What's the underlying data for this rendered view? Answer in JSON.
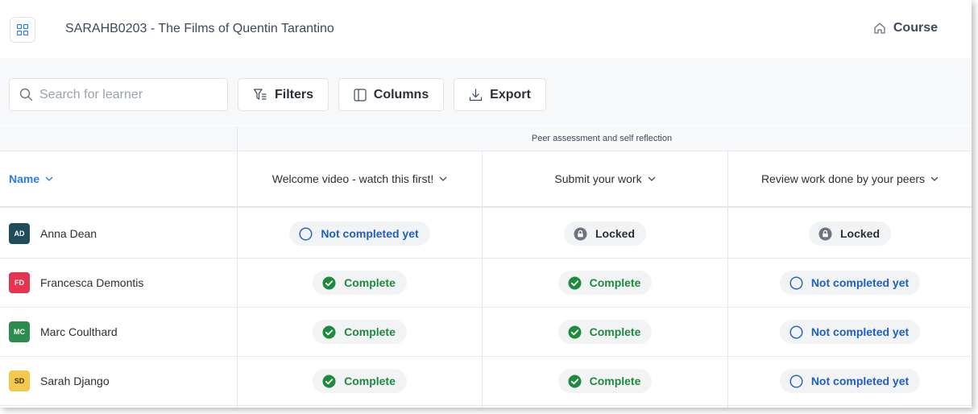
{
  "header": {
    "course_title": "SARAHB0203 - The Films of Quentin Tarantino",
    "course_link_label": "Course"
  },
  "toolbar": {
    "search_placeholder": "Search for learner",
    "filters_label": "Filters",
    "columns_label": "Columns",
    "export_label": "Export"
  },
  "table": {
    "group_label": "Peer assessment and self reflection",
    "columns": {
      "name": "Name",
      "col1": "Welcome video - watch this first!",
      "col2": "Submit your work",
      "col3": "Review work done by your peers"
    },
    "status_labels": {
      "not_completed": "Not completed yet",
      "complete": "Complete",
      "locked": "Locked"
    },
    "rows": [
      {
        "initials": "AD",
        "name": "Anna Dean",
        "avatar_color": "#1f4e5a",
        "status": [
          "not_completed",
          "locked",
          "locked"
        ]
      },
      {
        "initials": "FD",
        "name": "Francesca Demontis",
        "avatar_color": "#e53550",
        "status": [
          "complete",
          "complete",
          "not_completed"
        ]
      },
      {
        "initials": "MC",
        "name": "Marc Coulthard",
        "avatar_color": "#2e8b4e",
        "status": [
          "complete",
          "complete",
          "not_completed"
        ]
      },
      {
        "initials": "SD",
        "name": "Sarah Django",
        "avatar_color": "#f2c94c",
        "status": [
          "complete",
          "complete",
          "not_completed"
        ]
      }
    ]
  },
  "icons": {
    "apps": "grid-icon",
    "course": "home-icon",
    "search": "search-icon",
    "filters": "filter-icon",
    "columns": "columns-icon",
    "export": "download-icon",
    "complete": "check-circle-icon",
    "not_completed": "empty-circle-icon",
    "locked": "lock-icon",
    "sort": "chevron-down-icon"
  },
  "colors": {
    "accent_blue": "#2b7be4",
    "status_blue": "#1f5fc0",
    "status_green": "#1d8a3e",
    "locked_grey": "#6b7480"
  }
}
